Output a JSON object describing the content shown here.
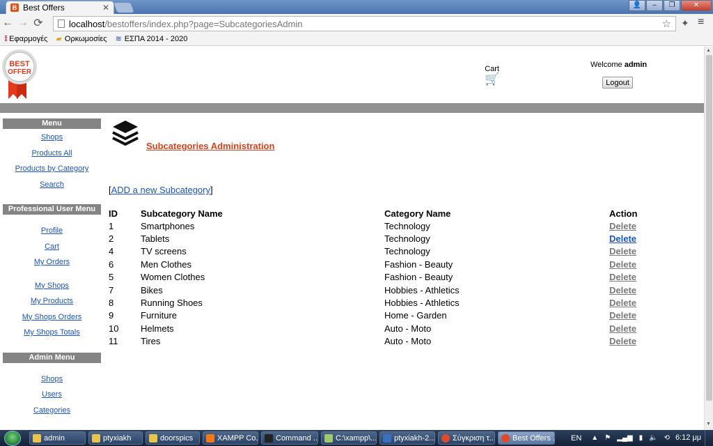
{
  "browser": {
    "tab_title": "Best Offers",
    "url_host": "localhost",
    "url_path": "/bestoffers/index.php?page=SubcategoriesAdmin",
    "bookmarks": [
      {
        "label": "Εφαρμογές",
        "icon": "apps-grid-icon"
      },
      {
        "label": "Ορκωμοσίες",
        "icon": "folder-icon"
      },
      {
        "label": "ΕΣΠΑ 2014 - 2020",
        "icon": "flag-icon"
      }
    ]
  },
  "header": {
    "logo_line1": "BEST",
    "logo_line2": "OFFER",
    "cart_label": "Cart",
    "welcome_text": "Welcome",
    "username": "admin",
    "logout_label": "Logout"
  },
  "sidebar": {
    "menu_heading": "Menu",
    "menu_items": [
      "Shops",
      "Products All",
      "Products by Category",
      "Search"
    ],
    "pro_heading": "Professional User Menu",
    "pro_items": [
      "Profile",
      "Cart",
      "My Orders"
    ],
    "pro_items_2": [
      "My Shops",
      "My Products",
      "My Shops Orders",
      "My Shops Totals"
    ],
    "admin_heading": "Admin Menu",
    "admin_items": [
      "Shops",
      "Users",
      "Categories"
    ]
  },
  "main": {
    "title": "Subcategories Administration",
    "add_open": "[",
    "add_label": "ADD a new Subcategory",
    "add_close": "]",
    "columns": [
      "ID",
      "Subcategory Name",
      "Category Name",
      "Action"
    ],
    "rows": [
      {
        "id": "1",
        "name": "Smartphones",
        "category": "Technology",
        "action": "Delete"
      },
      {
        "id": "2",
        "name": "Tablets",
        "category": "Technology",
        "action": "Delete"
      },
      {
        "id": "4",
        "name": "TV screens",
        "category": "Technology",
        "action": "Delete"
      },
      {
        "id": "6",
        "name": "Men Clothes",
        "category": "Fashion - Beauty",
        "action": "Delete"
      },
      {
        "id": "5",
        "name": "Women Clothes",
        "category": "Fashion - Beauty",
        "action": "Delete"
      },
      {
        "id": "7",
        "name": "Bikes",
        "category": "Hobbies - Athletics",
        "action": "Delete"
      },
      {
        "id": "8",
        "name": "Running Shoes",
        "category": "Hobbies - Athletics",
        "action": "Delete"
      },
      {
        "id": "9",
        "name": "Furniture",
        "category": "Home - Garden",
        "action": "Delete"
      },
      {
        "id": "10",
        "name": "Helmets",
        "category": "Auto - Moto",
        "action": "Delete"
      },
      {
        "id": "11",
        "name": "Tires",
        "category": "Auto - Moto",
        "action": "Delete"
      }
    ]
  },
  "taskbar": {
    "items": [
      {
        "label": "admin",
        "color": "#e8c44a"
      },
      {
        "label": "ptyxiakh",
        "color": "#e8c44a"
      },
      {
        "label": "doorspics",
        "color": "#e8c44a"
      },
      {
        "label": "XAMPP Co...",
        "color": "#f07a1a"
      },
      {
        "label": "Command ...",
        "color": "#222222"
      },
      {
        "label": "C:\\xampp\\...",
        "color": "#9fc96a"
      },
      {
        "label": "ptyxiakh-2...",
        "color": "#3a6fc2"
      },
      {
        "label": "Σύγκριση τ...",
        "color": "#e04a2a"
      },
      {
        "label": "Best Offers ...",
        "color": "#e04a2a",
        "active": true
      }
    ],
    "lang": "EN",
    "clock": "6:12 μμ"
  },
  "colors": {
    "title_accent": "#d9401e",
    "link": "#1a55c9",
    "sidebar_heading_bg": "#848484",
    "header_bar": "#909090"
  }
}
